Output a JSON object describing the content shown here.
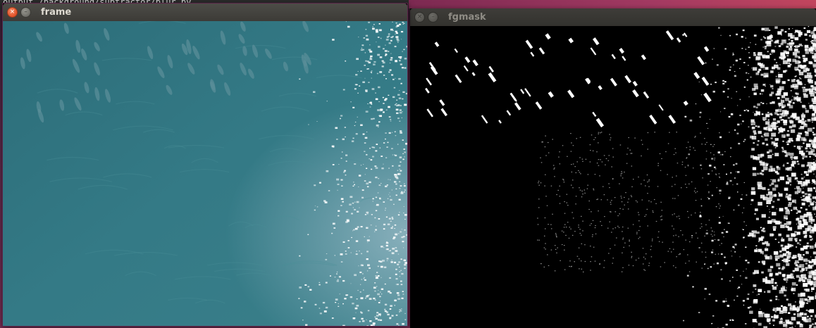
{
  "background": {
    "terminal_text": "output  /background/subtractor/blur.py"
  },
  "windows": {
    "frame": {
      "title": "frame",
      "close_glyph": "×",
      "minimize_glyph": "–",
      "image": {
        "icon": "video-frame-ocean-dolphins",
        "water_color": "#2f7380",
        "glare_color": "#ffffff"
      }
    },
    "fgmask": {
      "title": "fgmask",
      "close_glyph": "×",
      "minimize_glyph": "–",
      "image": {
        "icon": "foreground-mask-binary",
        "background_color": "#000000",
        "foreground_color": "#ffffff"
      }
    }
  }
}
